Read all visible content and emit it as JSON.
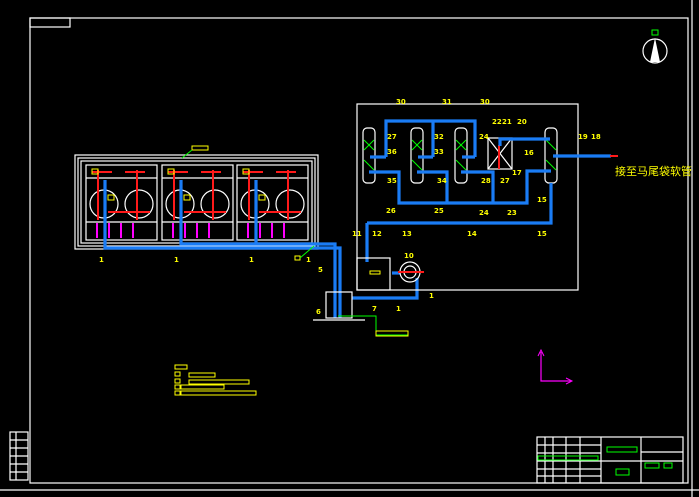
{
  "drawing": {
    "note_text": "接至马尾袋软管",
    "colors": {
      "background": "#000000",
      "frame": "#ffffff",
      "pipe": "#1a7cf5",
      "valve_red": "#ff1a1a",
      "label": "#ffff00",
      "leader_green": "#00ff00",
      "magenta": "#ff00ff"
    },
    "top_labels": [
      "30",
      "31",
      "30"
    ],
    "vessel_labels": [
      "27",
      "36",
      "35",
      "32",
      "33",
      "34",
      "24",
      "28",
      "27"
    ],
    "filter_labels": [
      "22",
      "21",
      "20",
      "17",
      "16"
    ],
    "outlet_labels": [
      "19",
      "18"
    ],
    "bottom_labels": [
      "26",
      "25",
      "24",
      "23",
      "15",
      "12",
      "13",
      "14",
      "15",
      "11"
    ],
    "unit_labels": [
      "1",
      "1",
      "1",
      "1",
      "5",
      "6",
      "7",
      "1",
      "10",
      "1"
    ],
    "icons": [
      "north-arrow-icon",
      "fan-icon",
      "valve-icon"
    ]
  }
}
